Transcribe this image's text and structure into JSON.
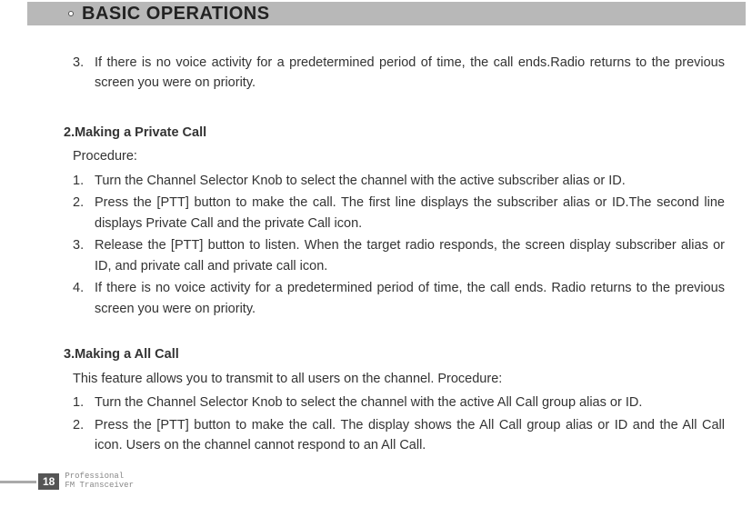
{
  "header": {
    "title": "BASIC OPERATIONS"
  },
  "orphan": {
    "num": "3.",
    "text": "If there is no voice activity for a predetermined period of time, the call ends.Radio returns to the previous screen you were on priority."
  },
  "sections": [
    {
      "title": "2.Making a Private Call",
      "intro": "Procedure:",
      "items": [
        {
          "num": "1.",
          "text": "Turn the Channel Selector Knob to select the channel with the active subscriber alias or ID."
        },
        {
          "num": "2.",
          "text": "Press the [PTT] button to make the call.  The first line displays the subscriber alias or ID.The second  line displays  Private Call  and  the private  Call  icon."
        },
        {
          "num": "3.",
          "text": "Release the [PTT] button to listen. When the target radio responds, the screen display subscriber alias or ID, and private call and private call icon."
        },
        {
          "num": "4.",
          "text": "If there is no voice activity for a predetermined period of time, the call ends. Radio returns to the previous screen you were on priority."
        }
      ]
    },
    {
      "title": "3.Making a All Call",
      "intro": "This feature allows you to transmit to all users on the channel. Procedure:",
      "items": [
        {
          "num": "1.",
          "text": "Turn the Channel Selector Knob to select the channel with the active All Call group alias or ID."
        },
        {
          "num": "2.",
          "text": "Press the [PTT] button to make the call. The display shows the All Call group alias or ID and the All Call icon. Users on the channel cannot respond to an All Call."
        }
      ]
    }
  ],
  "footer": {
    "page": "18",
    "line1": "Professional",
    "line2": "FM Transceiver"
  }
}
